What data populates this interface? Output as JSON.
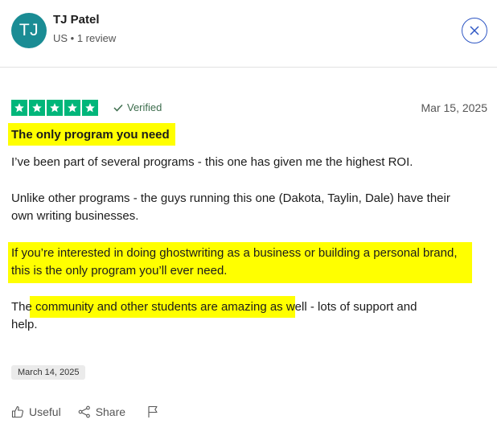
{
  "reviewer": {
    "initials": "TJ",
    "name": "TJ Patel",
    "meta": "US • 1 review",
    "avatar_color": "#1a8c94"
  },
  "review": {
    "rating": 5,
    "star_color": "#00b67a",
    "verified_label": "Verified",
    "date": "Mar 15, 2025",
    "title": "The only program you need",
    "paragraphs": [
      "I’ve been part of several programs - this one has given me the highest ROI.",
      "Unlike other programs - the guys running this one (Dakota, Taylin, Dale) have their own writing businesses.",
      "If you’re interested in doing ghostwriting as a business or building a personal brand, this is the only program you’ll ever need.",
      "The community and other students are amazing as well - lots of support and help."
    ],
    "experience_date": "March 14, 2025"
  },
  "actions": {
    "useful_label": "Useful",
    "share_label": "Share"
  },
  "highlight_color": "#ffff00"
}
